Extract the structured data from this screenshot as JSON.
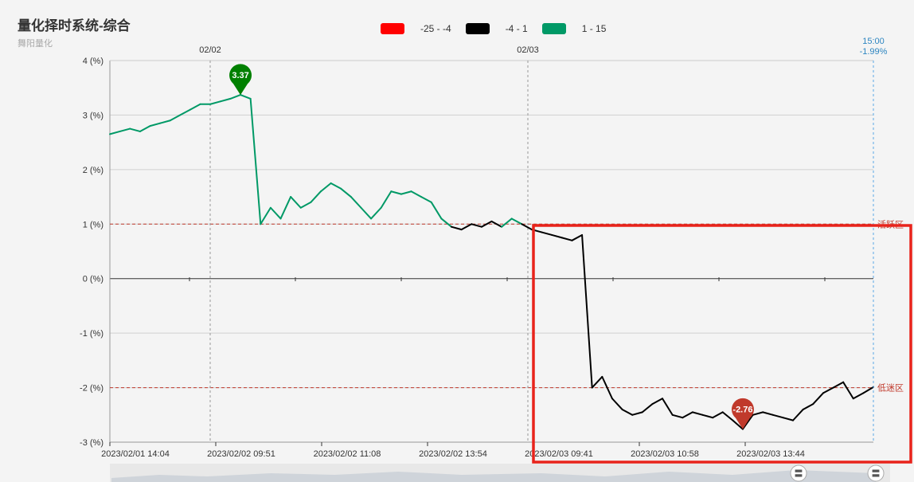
{
  "header": {
    "title": "量化择时系统-综合",
    "subtitle": "舞阳量化"
  },
  "legend": [
    {
      "label": "-25 - -4",
      "color": "#ff0000"
    },
    {
      "label": "-4 - 1",
      "color": "#000000"
    },
    {
      "label": "1 - 15",
      "color": "#009966"
    }
  ],
  "crosshair": {
    "time": "15:00",
    "value": "-1.99%"
  },
  "zones": {
    "upper_label": "活跃区",
    "lower_label": "低迷区",
    "upper_value": 1,
    "lower_value": -2
  },
  "day_markers": [
    {
      "label": "02/02",
      "x_index": 1
    },
    {
      "label": "02/03",
      "x_index": 4
    }
  ],
  "markers": {
    "max": {
      "label": "3.37",
      "color": "#008000"
    },
    "min": {
      "label": "-2.76",
      "color": "#c0392b"
    }
  },
  "chart_data": {
    "type": "line",
    "title": "量化择时系统-综合",
    "y_unit": "(%)",
    "ylim": [
      -3,
      4
    ],
    "y_ticks": [
      "4 (%)",
      "3 (%)",
      "2 (%)",
      "1 (%)",
      "0 (%)",
      "-1 (%)",
      "-2 (%)",
      "-3 (%)"
    ],
    "y_tick_values": [
      4,
      3,
      2,
      1,
      0,
      -1,
      -2,
      -3
    ],
    "x_tick_labels": [
      "2023/02/01 14:04",
      "2023/02/02 09:51",
      "2023/02/02 11:08",
      "2023/02/02 13:54",
      "2023/02/03 09:41",
      "2023/02/03 10:58",
      "2023/02/03 13:44"
    ],
    "grid": true,
    "series": [
      {
        "values": [
          2.65,
          2.7,
          2.75,
          2.7,
          2.8,
          2.85,
          2.9,
          3.0,
          3.1,
          3.2,
          3.2,
          3.25,
          3.3,
          3.37,
          3.3,
          1.0,
          1.3,
          1.1,
          1.5,
          1.3,
          1.4,
          1.6,
          1.75,
          1.65,
          1.5,
          1.3,
          1.1,
          1.3,
          1.6,
          1.55,
          1.6,
          1.5,
          1.4,
          1.1,
          0.95,
          0.9,
          1.0,
          0.95,
          1.05,
          0.95,
          1.1,
          1.0,
          0.9,
          0.85,
          0.8,
          0.75,
          0.7,
          0.8,
          -2.0,
          -1.8,
          -2.2,
          -2.4,
          -2.5,
          -2.45,
          -2.3,
          -2.2,
          -2.5,
          -2.55,
          -2.45,
          -2.5,
          -2.55,
          -2.45,
          -2.6,
          -2.76,
          -2.5,
          -2.45,
          -2.5,
          -2.55,
          -2.6,
          -2.4,
          -2.3,
          -2.1,
          -2.0,
          -1.9,
          -2.2,
          -2.1,
          -1.99
        ]
      }
    ]
  }
}
